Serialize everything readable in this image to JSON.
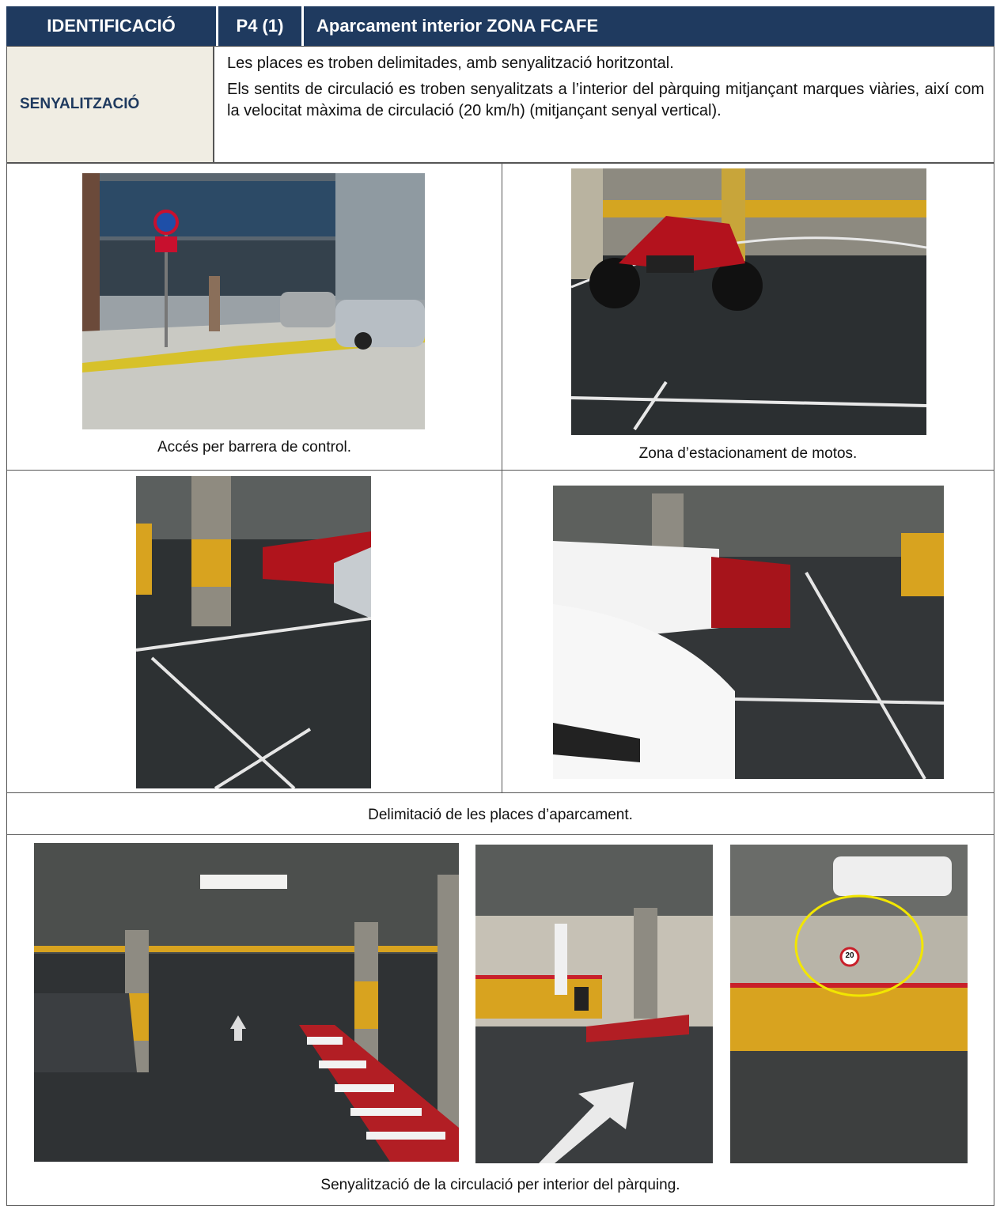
{
  "header": {
    "col1": "IDENTIFICACIÓ",
    "col2": "P4 (1)",
    "col3": "Aparcament interior ZONA FCAFE"
  },
  "senyalitzacio": {
    "label": "SENYALITZACIÓ",
    "paragraph1": "Les places es troben delimitades, amb senyalització horitzontal.",
    "paragraph2": "Els sentits de circulació es troben senyalitzats a l’interior del pàrquing mitjançant marques viàries, així com la velocitat màxima de circulació (20 km/h) (mitjançant senyal vertical)."
  },
  "photos": {
    "caption_access": "Accés per barrera de control.",
    "caption_motos": "Zona d’estacionament de motos.",
    "caption_places": "Delimitació de les places d’aparcament.",
    "caption_circulacio": "Senyalització de la circulació per interior del pàrquing.",
    "speed_sign": "20"
  },
  "colors": {
    "header_bg": "#1f3a5f",
    "label_bg": "#f0ede3",
    "highlight_circle": "#f2e600"
  }
}
